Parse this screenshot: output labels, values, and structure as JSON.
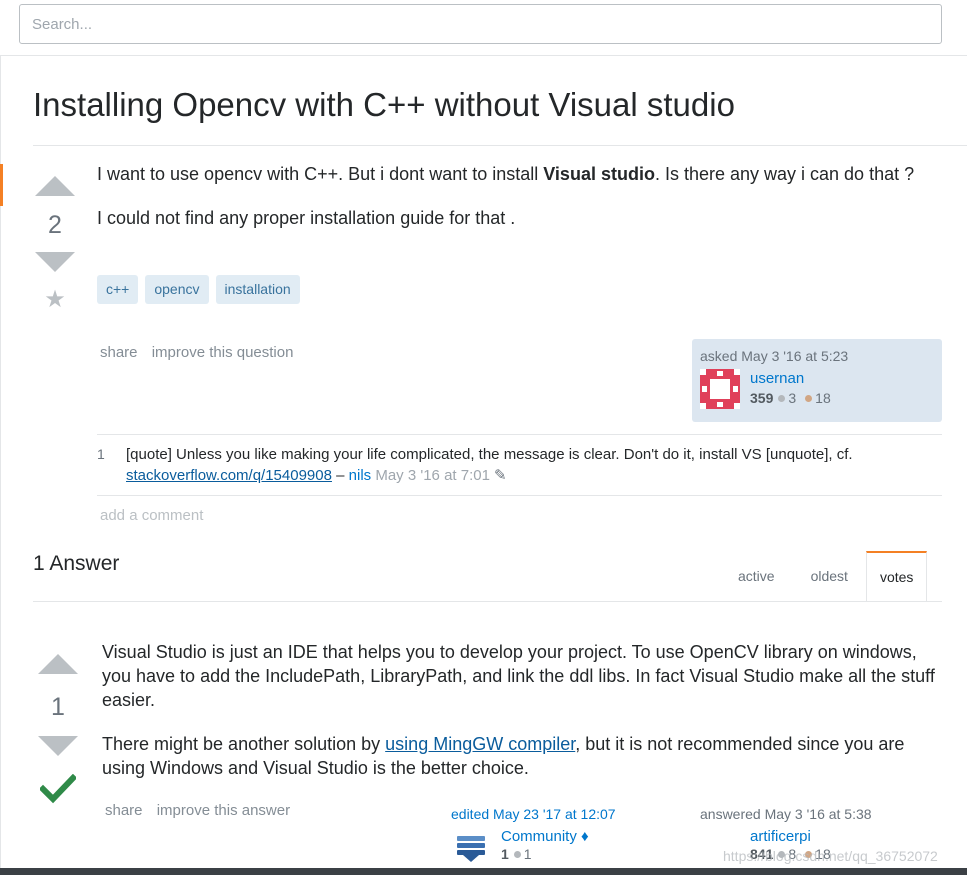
{
  "search": {
    "placeholder": "Search..."
  },
  "question": {
    "title": "Installing Opencv with C++ without Visual studio",
    "votes": "2",
    "para1_before": "I want to use opencv with C++. But i dont want to install ",
    "para1_bold": "Visual studio",
    "para1_after": ". Is there any way i can do that ?",
    "para2": "I could not find any proper installation guide for that .",
    "tags": [
      "c++",
      "opencv",
      "installation"
    ],
    "menu": {
      "share": "share",
      "improve": "improve this question"
    },
    "asked": {
      "action": "asked May 3 '16 at 5:23",
      "user": "usernan",
      "rep": "359",
      "silver": "3",
      "bronze": "18"
    },
    "comment": {
      "score": "1",
      "text": "[quote] Unless you like making your life complicated, the message is clear. Don't do it, install VS [unquote], cf.",
      "link": "stackoverflow.com/q/15409908",
      "dash": " – ",
      "user": "nils",
      "date": " May 3 '16 at 7:01"
    },
    "add_comment": "add a comment"
  },
  "answers": {
    "header": "1 Answer",
    "tabs": [
      "active",
      "oldest",
      "votes"
    ],
    "answer": {
      "votes": "1",
      "para1": "Visual Studio is just an IDE that helps you to develop your project. To use OpenCV library on windows, you have to add the IncludePath, LibraryPath, and link the ddl libs. In fact Visual Studio make all the stuff easier.",
      "para2_before": "There might be another solution by ",
      "para2_link": "using MingGW compiler",
      "para2_after": ", but it is not recommended since you are using Windows and Visual Studio is the better choice.",
      "menu": {
        "share": "share",
        "improve": "improve this answer"
      },
      "edited": {
        "action": "edited May 23 '17 at 12:07",
        "user": "Community ♦",
        "rep": "1",
        "silver": "1"
      },
      "answered": {
        "action": "answered May 3 '16 at 5:38",
        "user": "artificerpi",
        "rep": "841",
        "silver": "8",
        "bronze": "18"
      }
    }
  },
  "watermark": "https://blog.csdn.net/qq_36752072",
  "colors": {
    "accent": "#f48024",
    "link": "#0077cc",
    "tag_bg": "#e1ecf4",
    "tag_fg": "#39739d",
    "accepted": "#2f8a48",
    "user_card_bg": "#dce6f0"
  },
  "icons": [
    "vote-up-icon",
    "vote-down-icon",
    "favorite-star-icon",
    "accepted-check-icon",
    "edit-pencil-icon"
  ]
}
